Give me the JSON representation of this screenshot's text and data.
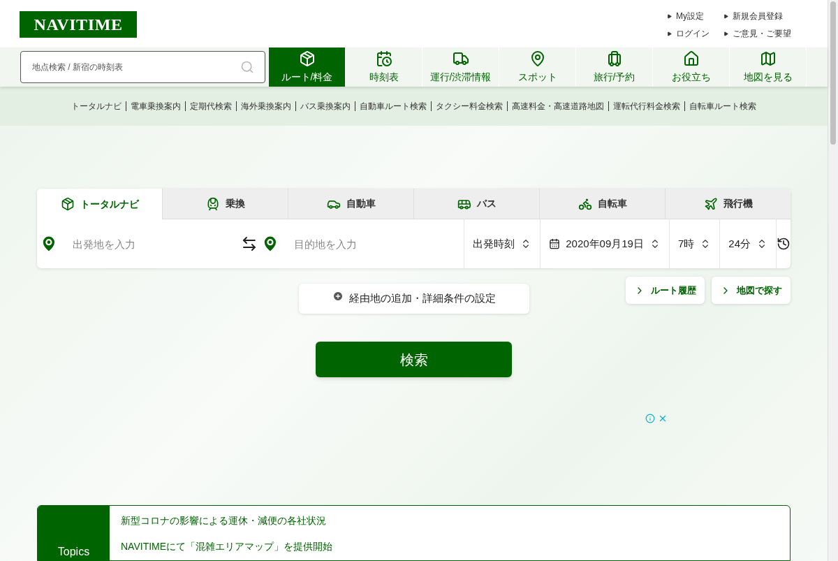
{
  "logo": "NAVITIME",
  "header_links": [
    {
      "label": "My設定"
    },
    {
      "label": "新規会員登録"
    },
    {
      "label": "ログイン"
    },
    {
      "label": "ご意見・ご要望"
    }
  ],
  "search": {
    "placeholder": "地点検索 / 新宿の時刻表"
  },
  "nav": [
    {
      "kind": "route",
      "label": "ルート/料金",
      "selected": true
    },
    {
      "kind": "timetable",
      "label": "時刻表",
      "selected": false
    },
    {
      "kind": "traffic",
      "label": "運行/渋滞情報",
      "selected": false
    },
    {
      "kind": "spot",
      "label": "スポット",
      "selected": false
    },
    {
      "kind": "travel",
      "label": "旅行/予約",
      "selected": false
    },
    {
      "kind": "useful",
      "label": "お役立ち",
      "selected": false
    },
    {
      "kind": "map",
      "label": "地図を見る",
      "selected": false
    }
  ],
  "sub_nav": [
    "トータルナビ",
    "電車乗換案内",
    "定期代検索",
    "海外乗換案内",
    "バス乗換案内",
    "自動車ルート検索",
    "タクシー料金検索",
    "高速料金・高速道路地図",
    "運転代行料金検索",
    "自転車ルート検索"
  ],
  "tabs": [
    {
      "kind": "total",
      "label": "トータルナビ",
      "selected": true
    },
    {
      "kind": "train",
      "label": "乗換",
      "selected": false
    },
    {
      "kind": "car",
      "label": "自動車",
      "selected": false
    },
    {
      "kind": "bus",
      "label": "バス",
      "selected": false
    },
    {
      "kind": "bike",
      "label": "自転車",
      "selected": false
    },
    {
      "kind": "plane",
      "label": "飛行機",
      "selected": false
    }
  ],
  "route_form": {
    "from_placeholder": "出発地を入力",
    "to_placeholder": "目的地を入力",
    "time_type": "出発時刻",
    "date": "2020年09月19日",
    "hour": "7時",
    "minute": "24分"
  },
  "options_button": "経由地の追加・詳細条件の設定",
  "side_buttons": [
    "ルート履歴",
    "地図で探す"
  ],
  "search_button": "検索",
  "topics": {
    "title": "Topics",
    "items": [
      "新型コロナの影響による運休・減便の各社状況",
      "NAVITIMEにて「混雑エリアマップ」を提供開始"
    ]
  }
}
